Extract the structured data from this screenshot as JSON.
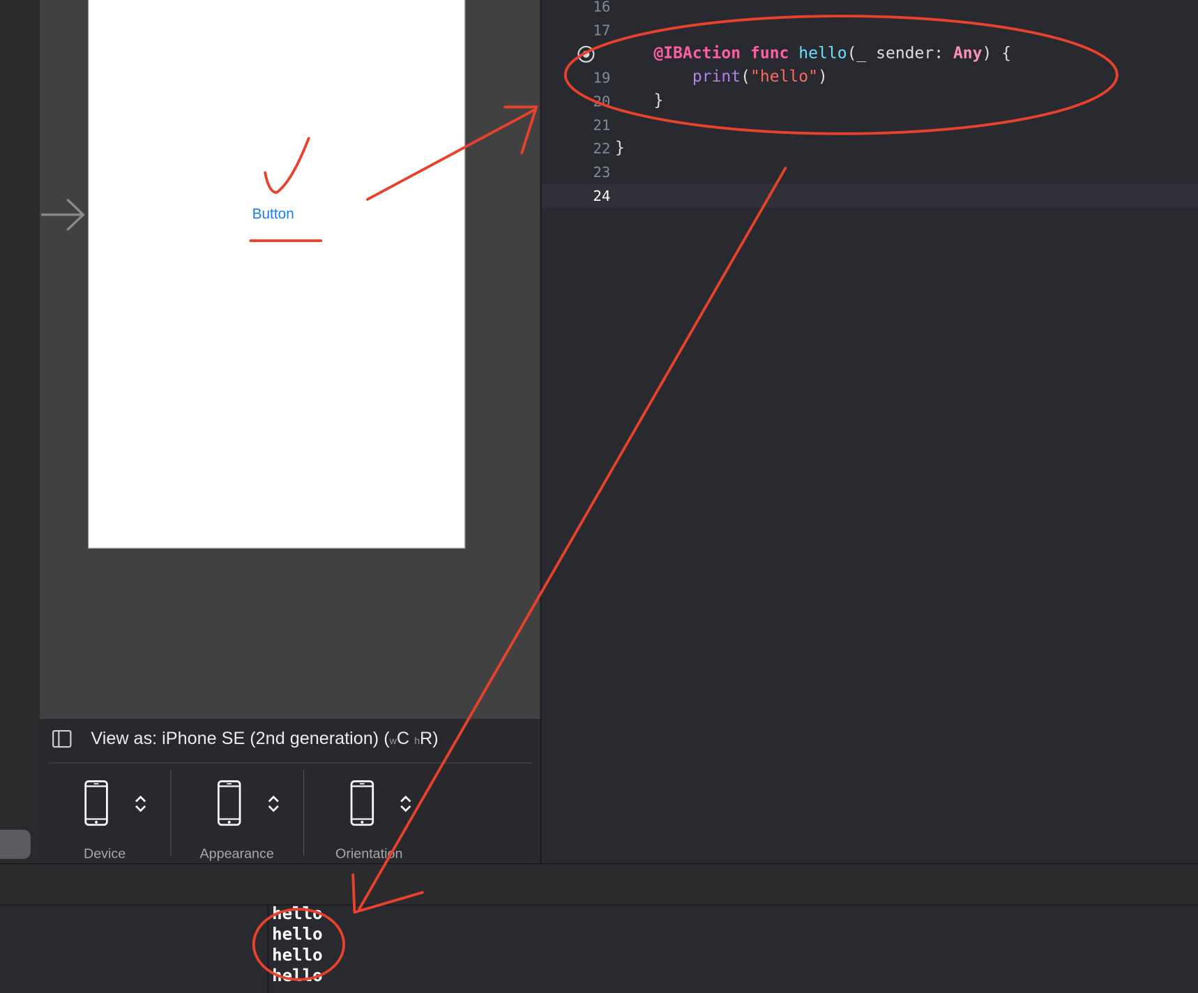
{
  "canvas": {
    "phone_button_label": "Button"
  },
  "device_bar": {
    "view_as_prefix": "View as: iPhone SE (2nd generation) (",
    "size_w_prefix": "w",
    "size_w_value": "C",
    "size_h_prefix": "h",
    "size_h_value": "R",
    "view_as_suffix": ")",
    "items": [
      {
        "label": "Device"
      },
      {
        "label": "Appearance"
      },
      {
        "label": "Orientation"
      }
    ]
  },
  "editor": {
    "line_numbers": [
      "16",
      "17",
      "19",
      "20",
      "21",
      "22",
      "23",
      "24"
    ],
    "current_line": "24",
    "code": {
      "attr": "@IBAction",
      "kw_func": "func",
      "func_name": "hello",
      "params_open": "(_ sender: ",
      "type_any": "Any",
      "params_close": ") {",
      "call": "print",
      "call_open": "(",
      "string_literal": "\"hello\"",
      "call_close": ")",
      "brace_inner": "}",
      "brace_outer": "}"
    }
  },
  "console": {
    "lines": [
      "hello",
      "hello",
      "hello",
      "hello"
    ]
  },
  "colors": {
    "annotation_red": "#e8412c",
    "keyword_pink": "#fc5fa3",
    "function_cyan": "#6bdfff",
    "call_purple": "#b281eb",
    "string_red": "#fc6a5d",
    "link_blue": "#1a7cf0"
  }
}
